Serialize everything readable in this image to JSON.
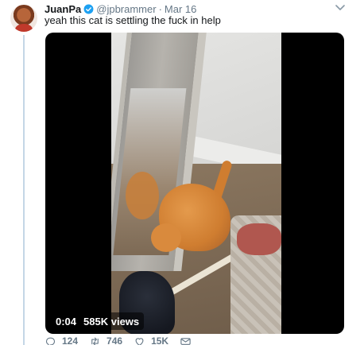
{
  "tweet": {
    "author_name": "JuanPa",
    "handle": "@jpbrammer",
    "separator": "·",
    "date": "Mar 16",
    "text": "yeah this cat is settling the fuck in help"
  },
  "video": {
    "time": "0:04",
    "views": "585K views"
  },
  "actions": {
    "reply_count": "124",
    "retweet_count": "746",
    "like_count": "15K"
  },
  "icons": {
    "verified": "verified-badge-icon",
    "caret": "chevron-down-icon",
    "reply": "reply-icon",
    "retweet": "retweet-icon",
    "like": "heart-icon",
    "dm": "envelope-icon"
  },
  "colors": {
    "verified_blue": "#1da1f2",
    "muted_text": "#657786",
    "thread_line": "#c4d6e6"
  }
}
